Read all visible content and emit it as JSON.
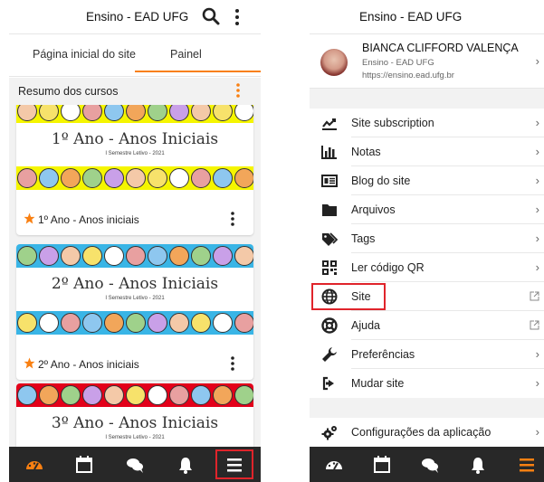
{
  "left": {
    "header": {
      "title": "Ensino - EAD UFG"
    },
    "tabs": [
      {
        "label": "Página inicial do site"
      },
      {
        "label": "Painel"
      }
    ],
    "section": {
      "title": "Resumo dos cursos"
    },
    "courses": [
      {
        "banner_title": "1º Ano - Anos Iniciais",
        "banner_subtitle": "I Semestre Letivo - 2021",
        "name": "1º Ano - Anos iniciais",
        "color": "#f5f500"
      },
      {
        "banner_title": "2º Ano - Anos Iniciais",
        "banner_subtitle": "I Semestre Letivo - 2021",
        "name": "2º Ano - Anos iniciais",
        "color": "#39b5e6"
      },
      {
        "banner_title": "3º Ano - Anos Iniciais",
        "banner_subtitle": "I Semestre Letivo - 2021",
        "name": "",
        "color": "#e3001a"
      }
    ],
    "bottom_nav": [
      "dashboard-icon",
      "calendar-icon",
      "messages-icon",
      "notifications-icon",
      "menu-icon"
    ]
  },
  "right": {
    "header": {
      "title": "Ensino - EAD UFG"
    },
    "user": {
      "name": "BIANCA CLIFFORD VALENÇA",
      "site": "Ensino - EAD UFG",
      "url": "https://ensino.ead.ufg.br"
    },
    "menu": [
      {
        "label": "Site subscription",
        "icon": "chart-icon",
        "trailing": "chevron"
      },
      {
        "label": "Notas",
        "icon": "grades-icon",
        "trailing": "chevron"
      },
      {
        "label": "Blog do site",
        "icon": "blog-icon",
        "trailing": "chevron"
      },
      {
        "label": "Arquivos",
        "icon": "folder-icon",
        "trailing": "chevron"
      },
      {
        "label": "Tags",
        "icon": "tag-icon",
        "trailing": "chevron"
      },
      {
        "label": "Ler código QR",
        "icon": "qrcode-icon",
        "trailing": "chevron"
      },
      {
        "label": "Site",
        "icon": "globe-icon",
        "trailing": "external"
      },
      {
        "label": "Ajuda",
        "icon": "lifebuoy-icon",
        "trailing": "external"
      },
      {
        "label": "Preferências",
        "icon": "wrench-icon",
        "trailing": "chevron"
      },
      {
        "label": "Mudar site",
        "icon": "switch-site-icon",
        "trailing": "chevron"
      }
    ],
    "settings": {
      "label": "Configurações da aplicação",
      "icon": "cogs-icon"
    },
    "bottom_nav": [
      "dashboard-icon",
      "calendar-icon",
      "messages-icon",
      "notifications-icon",
      "menu-icon"
    ]
  },
  "colors": {
    "accent": "#f98012",
    "highlight": "#e0242b",
    "bar": "#282828"
  }
}
